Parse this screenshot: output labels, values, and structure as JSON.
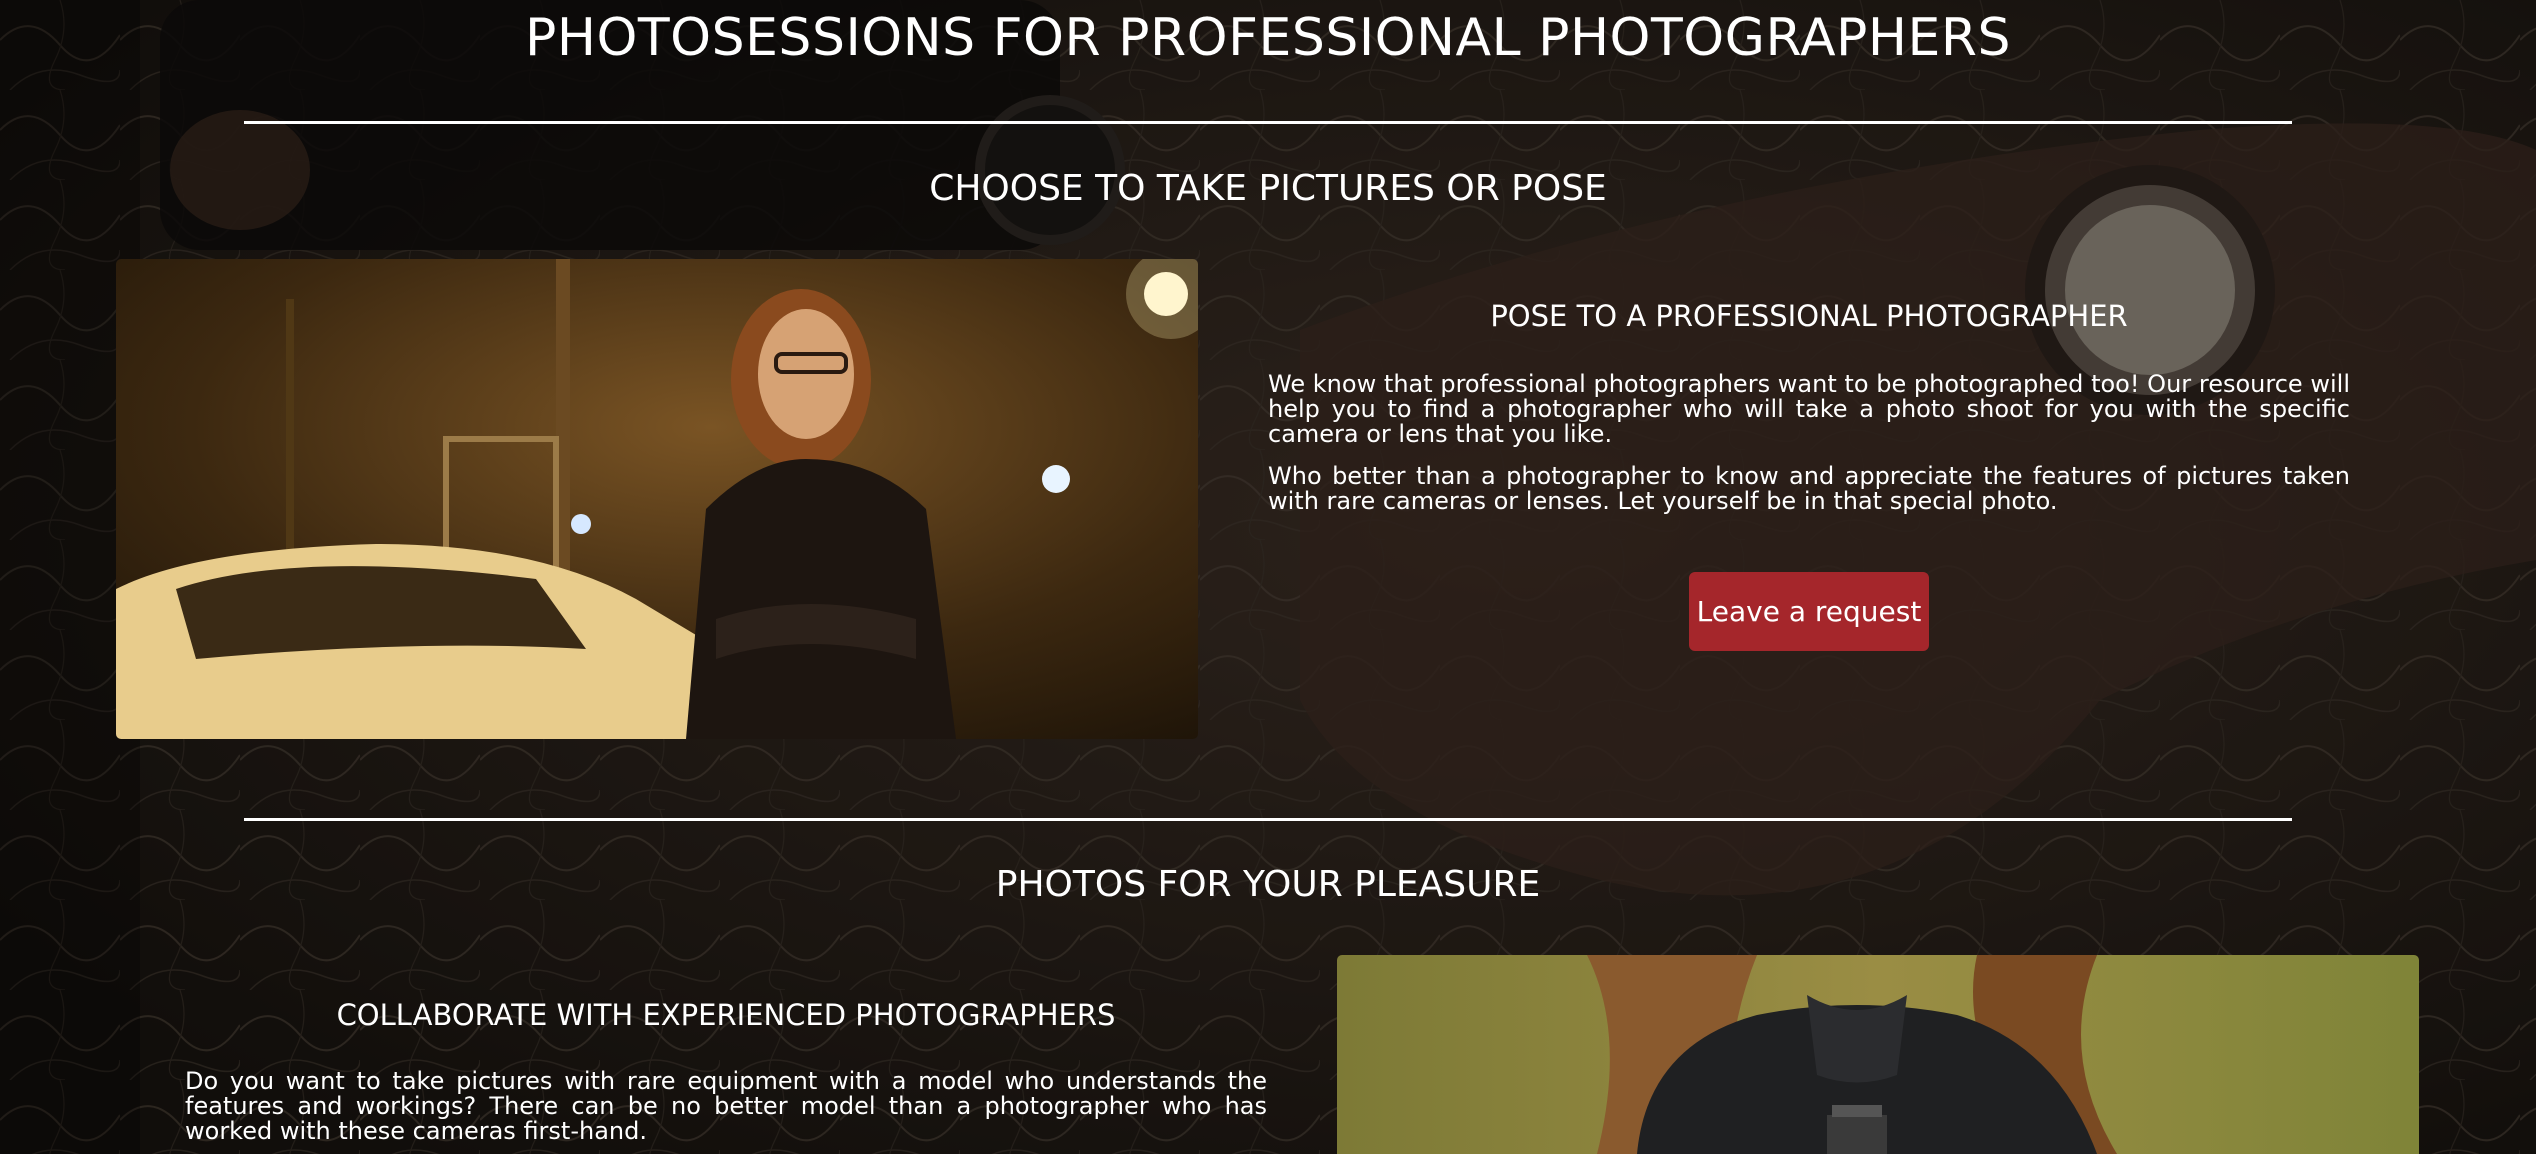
{
  "page": {
    "title": "PHOTOSESSIONS FOR PROFESSIONAL PHOTOGRAPHERS"
  },
  "section_pose": {
    "title": "CHOOSE TO TAKE PICTURES OR POSE",
    "card_title": "POSE TO A PROFESSIONAL PHOTOGRAPHER",
    "paragraph_1": "We know that professional photographers want to be photographed too! Our resource will help you to find a photographer who will take a photo shoot for you with the specific camera or lens that you like.",
    "paragraph_2": "Who better than a photographer to know and appreciate the features of pictures taken with rare cameras or lenses. Let yourself be in that special photo.",
    "button_label": "Leave a request"
  },
  "section_pleasure": {
    "title": "PHOTOS FOR YOUR PLEASURE",
    "card_title": "COLLABORATE WITH EXPERIENCED PHOTOGRAPHERS",
    "paragraph_1": "Do you want to take pictures with rare equipment with a model who understands the features and workings? There can be no better model than a photographer who has worked with these cameras first-hand."
  },
  "colors": {
    "accent": "#a5262b",
    "text": "#ffffff",
    "background": "#1d1814"
  },
  "icons": [
    "woman-night-street-photo",
    "woman-field-photo"
  ]
}
